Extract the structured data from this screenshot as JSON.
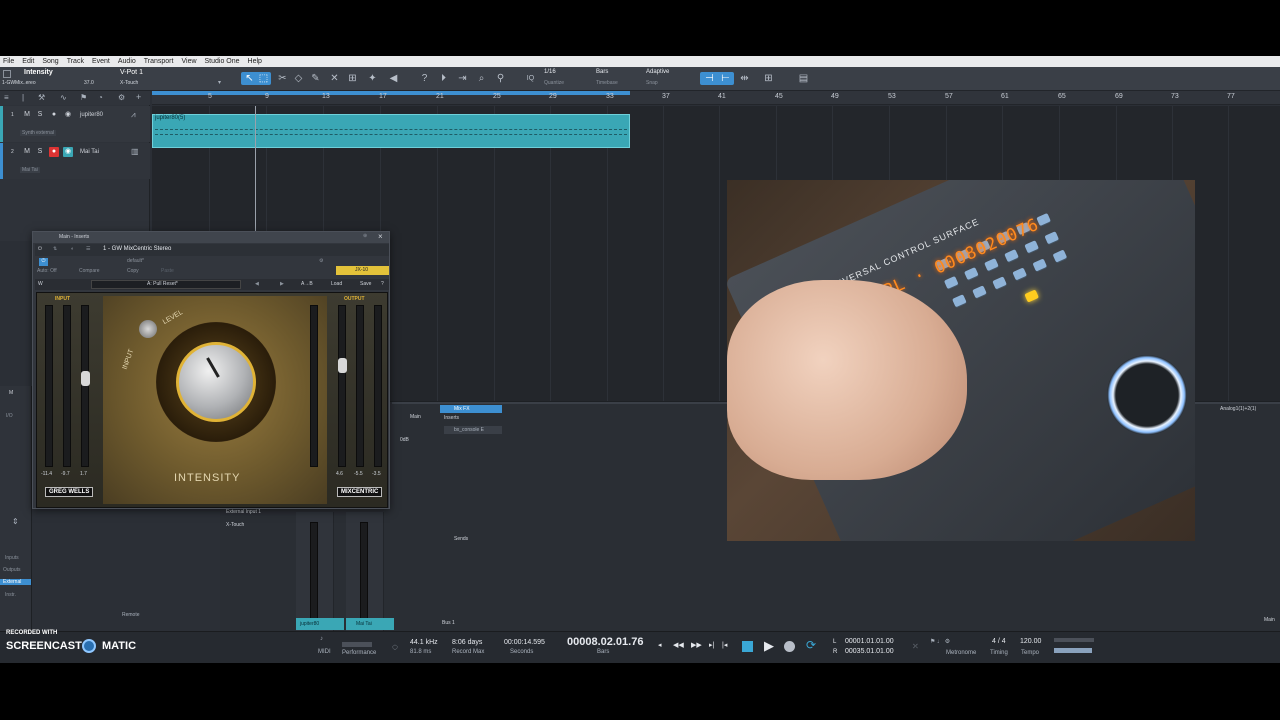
{
  "menu": [
    "File",
    "Edit",
    "Song",
    "Track",
    "Event",
    "Audio",
    "Transport",
    "View",
    "Studio One",
    "Help"
  ],
  "toolbar": {
    "device_title": "Intensity",
    "device_sub": "1-GWMix..ereo",
    "device_value": "37.0",
    "surface_name": "V-Pot 1",
    "surface_sub": "X-Touch",
    "quantize_value": "1/16",
    "quantize_label": "Quantize",
    "timebase_value": "Bars",
    "timebase_label": "Timebase",
    "snap_value": "Adaptive",
    "snap_label": "Snap"
  },
  "ruler": [
    "5",
    "9",
    "13",
    "17",
    "21",
    "25",
    "29",
    "33",
    "37",
    "41",
    "45",
    "49",
    "53",
    "57",
    "61",
    "65",
    "69",
    "73",
    "77"
  ],
  "tracks": [
    {
      "num": "1",
      "name": "jupiter80",
      "input": "Synth external",
      "clip": "jupiter80(5)"
    },
    {
      "num": "2",
      "name": "Mai Tai",
      "input": "Mai Tai"
    }
  ],
  "plugin": {
    "window_title": "Main - Inserts",
    "insert_name": "1 - GW MixCentric Stereo",
    "preset": "default*",
    "auto": "Auto: Off",
    "compare": "Compare",
    "copy": "Copy",
    "paste": "Paste",
    "device_tag": "JX-10",
    "preset_bar": "A: Pull Reset*",
    "ab": "A→B",
    "load": "Load",
    "save": "Save",
    "help": "?",
    "input_label": "INPUT",
    "output_label": "OUTPUT",
    "gr_label": "GR",
    "level_label": "LEVEL",
    "knob_label": "INPUT",
    "intensity_label": "INTENSITY",
    "brand_left": "GREG WELLS",
    "brand_right": "MIXCENTRIC",
    "in_readings": [
      "-11.4",
      "-9.7",
      "1.7"
    ],
    "out_readings": [
      "4.6",
      "-5.5",
      "-3.5"
    ]
  },
  "video": {
    "surface_text": "UNIVERSAL CONTROL SURFACE",
    "display": "PL · 0008020076"
  },
  "mixer": {
    "mixfx": "Mix FX",
    "inserts": "Inserts",
    "insert_item": "bx_console E",
    "sends": "Sends",
    "main": "Main",
    "db": "0dB",
    "ext_in": "External Input 1",
    "xtouch": "X-Touch",
    "bus": "Bus 1",
    "auto_off": "Auto: Off",
    "ch1": "jupiter80",
    "ch2": "Mai Tai",
    "right_label": "Analog1(1)+2(1)",
    "right_main": "Main",
    "side_items": [
      "Inputs",
      "Outputs",
      "External",
      "Instr."
    ],
    "remote": "Remote"
  },
  "transport": {
    "midi": "MIDI",
    "performance": "Performance",
    "sample_rate": "44.1 kHz",
    "latency": "81.8 ms",
    "record_days": "8:06 days",
    "record_max": "Record Max",
    "seconds_val": "00:00:14.595",
    "seconds_label": "Seconds",
    "position": "00008.02.01.76",
    "bars": "Bars",
    "loop_start": "00001.01.01.00",
    "loop_end": "00035.01.01.00",
    "metronome": "Metronome",
    "signature": "4 / 4",
    "timing": "Timing",
    "tempo_val": "120.00",
    "tempo": "Tempo"
  },
  "watermark": {
    "line1": "RECORDED WITH",
    "brand_a": "SCREENCAST",
    "brand_b": "MATIC"
  }
}
